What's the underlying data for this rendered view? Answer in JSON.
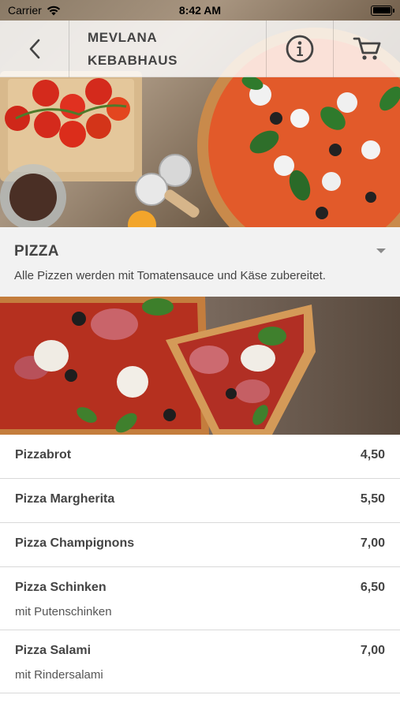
{
  "status_bar": {
    "carrier": "Carrier",
    "time": "8:42 AM"
  },
  "nav": {
    "title_line1": "MEVLANA",
    "title_line2": "KEBABHAUS",
    "icons": [
      "back-chevron-icon",
      "info-icon",
      "cart-icon"
    ]
  },
  "category": {
    "title": "PIZZA",
    "description": "Alle Pizzen werden mit Tomatensauce und Käse zubereitet."
  },
  "menu": {
    "items": [
      {
        "name": "Pizzabrot",
        "price": "4,50",
        "description": ""
      },
      {
        "name": "Pizza Margherita",
        "price": "5,50",
        "description": ""
      },
      {
        "name": "Pizza Champignons",
        "price": "7,00",
        "description": ""
      },
      {
        "name": "Pizza Schinken",
        "price": "6,50",
        "description": "mit Putenschinken"
      },
      {
        "name": "Pizza Salami",
        "price": "7,00",
        "description": "mit Rindersalami"
      }
    ]
  },
  "colors": {
    "accent": "#444444",
    "category_bg": "#f2f2f2",
    "divider": "#d9d9d9"
  }
}
